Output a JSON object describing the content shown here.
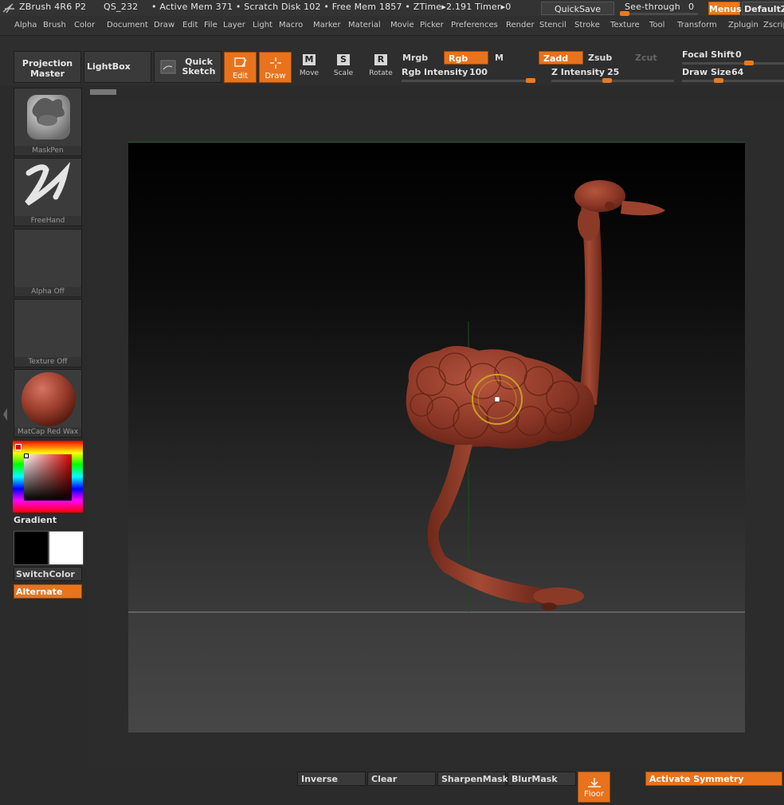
{
  "titlebar": {
    "app": "ZBrush 4R6 P2",
    "qs": "QS_232",
    "status": "• Active Mem 371 • Scratch Disk 102 • Free Mem 1857 • ZTime▸2.191 Timer▸0",
    "quicksave": "QuickSave",
    "seethrough": "See-through",
    "seethrough_value": "0",
    "menus": "Menus",
    "defaultz": "DefaultZ"
  },
  "menubar": [
    "Alpha",
    "Brush",
    "Color",
    "Document",
    "Draw",
    "Edit",
    "File",
    "Layer",
    "Light",
    "Macro",
    "Marker",
    "Material",
    "Movie",
    "Picker",
    "Preferences",
    "Render",
    "Stencil",
    "Stroke",
    "Texture",
    "Tool",
    "Transform",
    "Zplugin",
    "Zscript"
  ],
  "toolbar": {
    "projection_master": [
      "Projection",
      "Master"
    ],
    "lightbox": "LightBox",
    "quick_sketch": [
      "Quick",
      "Sketch"
    ],
    "edit": "Edit",
    "draw": "Draw",
    "move": "Move",
    "scale": "Scale",
    "rotate": "Rotate",
    "move_glyph": "M",
    "scale_glyph": "S",
    "rotate_glyph": "R",
    "mrgb": "Mrgb",
    "rgb": "Rgb",
    "m": "M",
    "zadd": "Zadd",
    "zsub": "Zsub",
    "zcut": "Zcut",
    "rgb_intensity_label": "Rgb Intensity",
    "rgb_intensity": "100",
    "z_intensity_label": "Z Intensity",
    "z_intensity": "25",
    "focal_shift_label": "Focal Shift",
    "focal_shift": "0",
    "draw_size_label": "Draw Size",
    "draw_size": "64"
  },
  "shelf": {
    "maskpen": "MaskPen",
    "freehand": "FreeHand",
    "alpha": "Alpha Off",
    "texture": "Texture Off",
    "material": "MatCap Red Wax",
    "gradient": "Gradient",
    "switchcolor": "SwitchColor",
    "alternate": "Alternate"
  },
  "bottombar": {
    "inverse": "Inverse",
    "clear": "Clear",
    "sharpenmask": "SharpenMask",
    "blurmask": "BlurMask",
    "floor": "Floor",
    "activate_symmetry": "Activate Symmetry"
  },
  "colors": {
    "accent": "#e8731c",
    "model": "#8a3a2a",
    "brush_ring": "#c9a21e"
  }
}
